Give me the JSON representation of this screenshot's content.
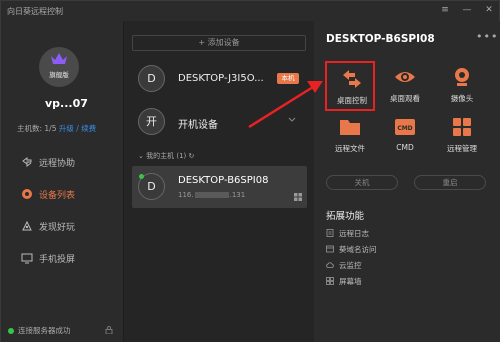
{
  "app": {
    "title": "向日葵远程控制"
  },
  "window_buttons": [
    "≡",
    "—",
    "✕"
  ],
  "sidebar": {
    "avatar_label": "旗舰版",
    "username": "vp...07",
    "host_count_label": "主机数: 1/5",
    "upgrade_link": "升级",
    "separator": "/",
    "renew_link": "续费",
    "nav": [
      {
        "label": "远程协助",
        "icon": "remote-assist-icon",
        "active": false
      },
      {
        "label": "设备列表",
        "icon": "device-list-icon",
        "active": true
      },
      {
        "label": "发现好玩",
        "icon": "discover-icon",
        "active": false
      },
      {
        "label": "手机投屏",
        "icon": "cast-icon",
        "active": false
      }
    ],
    "status": "连接服务器成功"
  },
  "device_list": {
    "add_button": "+ 添加设备",
    "local_device": {
      "avatar": "D",
      "name": "DESKTOP-J3I5O...",
      "badge": "本机"
    },
    "power_device": {
      "avatar": "开",
      "name": "开机设备"
    },
    "group_label": "我的主机 (1)",
    "selected": {
      "avatar": "D",
      "name": "DESKTOP-B6SPI08",
      "ip_prefix": "116.",
      "ip_suffix": ".131"
    }
  },
  "panel": {
    "title": "DESKTOP-B6SPI08",
    "more": "•••",
    "actions": [
      {
        "label": "桌面控制",
        "icon": "desktop-control-icon"
      },
      {
        "label": "桌面观看",
        "icon": "desktop-view-icon"
      },
      {
        "label": "摄像头",
        "icon": "camera-icon"
      },
      {
        "label": "远程文件",
        "icon": "remote-file-icon"
      },
      {
        "label": "CMD",
        "icon": "cmd-icon"
      },
      {
        "label": "远程管理",
        "icon": "remote-manage-icon"
      }
    ],
    "cmd_icon_text": "CMD",
    "shutdown": "关机",
    "restart": "重启",
    "ext_title": "拓展功能",
    "ext_items": [
      {
        "label": "远程日志",
        "icon": "log-icon"
      },
      {
        "label": "葵域名访问",
        "icon": "domain-icon"
      },
      {
        "label": "云监控",
        "icon": "cloud-icon"
      },
      {
        "label": "屏幕墙",
        "icon": "screen-wall-icon"
      }
    ]
  },
  "colors": {
    "accent": "#e8774a",
    "link": "#3b8ee8",
    "online": "#39c54a",
    "annotation": "#e82222"
  }
}
